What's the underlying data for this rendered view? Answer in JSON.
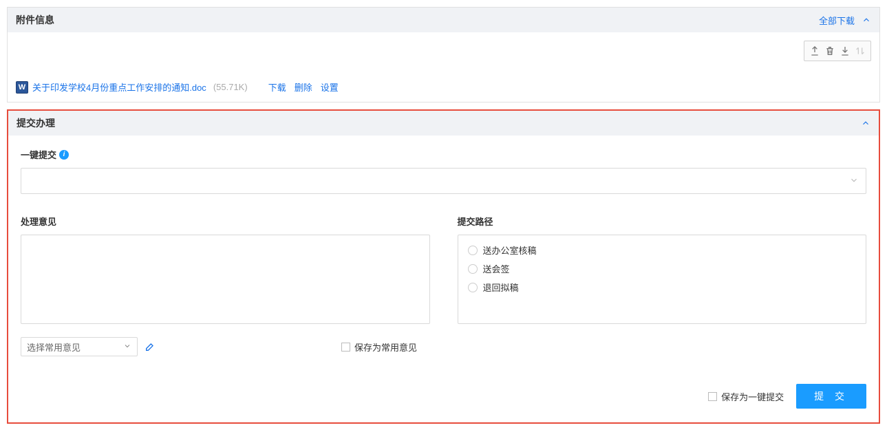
{
  "attachments": {
    "title": "附件信息",
    "download_all": "全部下载",
    "file": {
      "icon_letter": "W",
      "name": "关于印发学校4月份重点工作安排的通知.doc",
      "size": "(55.71K)",
      "download": "下载",
      "delete": "删除",
      "settings": "设置"
    }
  },
  "submit": {
    "title": "提交办理",
    "quick_submit_label": "一键提交",
    "quick_submit_value": "",
    "opinion_label": "处理意见",
    "opinion_value": "",
    "path_label": "提交路径",
    "paths": {
      "p0": "送办公室核稿",
      "p1": "送会签",
      "p2": "退回拟稿"
    },
    "select_common": "选择常用意见",
    "save_common": "保存为常用意见",
    "save_quick": "保存为一键提交",
    "submit_btn": "提 交"
  }
}
